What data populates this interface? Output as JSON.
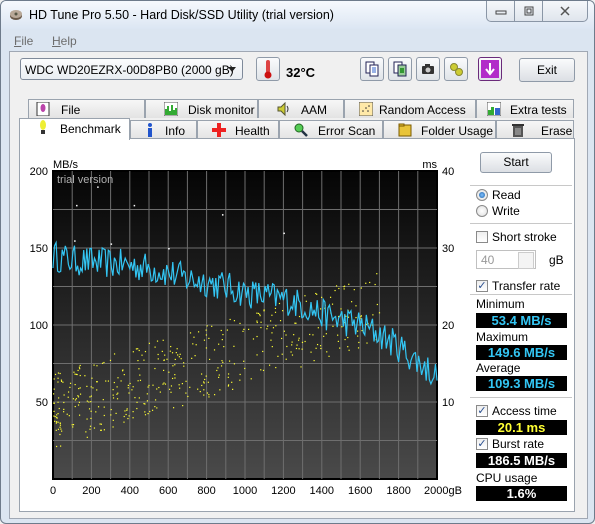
{
  "window": {
    "title": "HD Tune Pro 5.50 - Hard Disk/SSD Utility (trial version)",
    "app_icon": "hdd-icon",
    "controls": [
      "minimize",
      "maximize",
      "close"
    ]
  },
  "menu": [
    {
      "label": "File",
      "accel": "F"
    },
    {
      "label": "Help",
      "accel": "H"
    }
  ],
  "toolbar": {
    "drive": "WDC WD20EZRX-00D8PB0 (2000 gB)",
    "temperature": "32°C",
    "buttons": [
      {
        "icon": "copy-text-icon"
      },
      {
        "icon": "copy-screen-icon"
      },
      {
        "icon": "camera-icon"
      },
      {
        "icon": "options-icon"
      },
      {
        "icon": "download-icon"
      }
    ],
    "exit_label": "Exit"
  },
  "tabs_back": [
    {
      "label": "File Benchmark",
      "icon": "file-benchmark-icon"
    },
    {
      "label": "Disk monitor",
      "icon": "disk-monitor-icon"
    },
    {
      "label": "AAM",
      "icon": "speaker-icon"
    },
    {
      "label": "Random Access",
      "icon": "random-access-icon"
    },
    {
      "label": "Extra tests",
      "icon": "extra-tests-icon"
    }
  ],
  "tabs_front": [
    {
      "label": "Benchmark",
      "icon": "benchmark-icon",
      "active": true
    },
    {
      "label": "Info",
      "icon": "info-icon"
    },
    {
      "label": "Health",
      "icon": "health-cross-icon"
    },
    {
      "label": "Error Scan",
      "icon": "magnifier-icon"
    },
    {
      "label": "Folder Usage",
      "icon": "folder-icon"
    },
    {
      "label": "Erase",
      "icon": "trash-icon"
    }
  ],
  "side": {
    "start_label": "Start",
    "read_label": "Read",
    "write_label": "Write",
    "mode": "Read",
    "short_stroke_label": "Short stroke",
    "short_stroke_checked": false,
    "short_stroke_value": "40",
    "short_stroke_unit": "gB",
    "transfer_rate_label": "Transfer rate",
    "transfer_rate_checked": true,
    "minimum_label": "Minimum",
    "minimum_value": "53.4 MB/s",
    "maximum_label": "Maximum",
    "maximum_value": "149.6 MB/s",
    "average_label": "Average",
    "average_value": "109.3 MB/s",
    "access_time_label": "Access time",
    "access_time_checked": true,
    "access_time_value": "20.1 ms",
    "burst_rate_label": "Burst rate",
    "burst_rate_checked": true,
    "burst_rate_value": "186.5 MB/s",
    "cpu_usage_label": "CPU usage",
    "cpu_usage_value": "1.6%",
    "colors": {
      "transfer": "#33c6f4",
      "access": "#ffff33",
      "burst": "#ffffff"
    }
  },
  "chart_data": {
    "type": "line",
    "watermark": "trial version",
    "xlabel": "gB",
    "ylabel_left": "MB/s",
    "ylabel_right": "ms",
    "xlim": [
      0,
      2000
    ],
    "ylim_left": [
      0,
      200
    ],
    "ylim_right": [
      0,
      40
    ],
    "x_ticks": [
      0,
      200,
      400,
      600,
      800,
      1000,
      1200,
      1400,
      1600,
      1800,
      2000
    ],
    "x_tick_labels": [
      "0",
      "200",
      "400",
      "600",
      "800",
      "1000",
      "1200",
      "1400",
      "1600",
      "1800",
      "2000gB"
    ],
    "y_left_ticks": [
      50,
      100,
      150,
      200
    ],
    "y_right_ticks": [
      10,
      20,
      30,
      40
    ],
    "grid": true,
    "series": [
      {
        "name": "Transfer rate",
        "axis": "left",
        "unit": "MB/s",
        "color": "#33c6f4",
        "x": [
          0,
          100,
          200,
          300,
          400,
          500,
          600,
          700,
          800,
          900,
          1000,
          1100,
          1200,
          1300,
          1400,
          1500,
          1600,
          1700,
          1800,
          1900,
          2000
        ],
        "values": [
          145,
          142,
          141,
          140,
          139,
          137,
          134,
          130,
          128,
          125,
          121,
          119,
          117,
          113,
          107,
          103,
          100,
          94,
          86,
          76,
          67
        ]
      },
      {
        "name": "Access time",
        "axis": "right",
        "unit": "ms",
        "color": "#ffff33",
        "style": "scatter",
        "description": "widely scattered points roughly between 4 and 27 ms; denser and lower near the start of the disk, rising toward 20-27 ms in the middle region",
        "average": 20.1
      }
    ]
  }
}
